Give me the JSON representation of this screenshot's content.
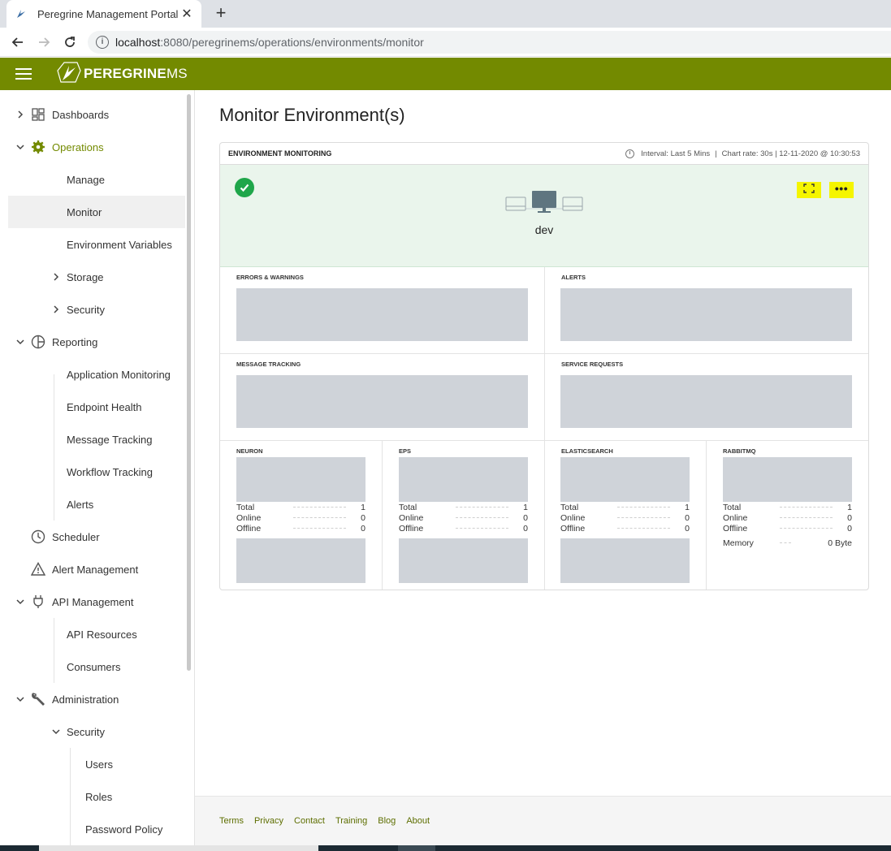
{
  "browser": {
    "tab_title": "Peregrine Management Portal",
    "url_host": "localhost",
    "url_path": ":8080/peregrinems/operations/environments/monitor"
  },
  "header": {
    "brand_bold": "PEREGRINE",
    "brand_light": "MS",
    "accent_color": "#738a00"
  },
  "sidebar": {
    "dashboards": "Dashboards",
    "operations": "Operations",
    "manage": "Manage",
    "monitor": "Monitor",
    "environment_variables": "Environment Variables",
    "storage": "Storage",
    "security": "Security",
    "reporting": "Reporting",
    "application_monitoring": "Application Monitoring",
    "endpoint_health": "Endpoint Health",
    "message_tracking": "Message Tracking",
    "workflow_tracking": "Workflow Tracking",
    "alerts": "Alerts",
    "scheduler": "Scheduler",
    "alert_management": "Alert Management",
    "api_management": "API Management",
    "api_resources": "API Resources",
    "consumers": "Consumers",
    "administration": "Administration",
    "admin_security": "Security",
    "users": "Users",
    "roles": "Roles",
    "password_policy": "Password Policy"
  },
  "main": {
    "page_title": "Monitor Environment(s)",
    "card": {
      "title": "ENVIRONMENT MONITORING",
      "interval": "Interval: Last 5 Mins",
      "chart_rate": "Chart rate: 30s | 12-11-2020 @ 10:30:53",
      "env_name": "dev",
      "status_color": "#1fa64a"
    },
    "panels": {
      "errors": "ERRORS & WARNINGS",
      "alerts": "ALERTS",
      "message_tracking": "MESSAGE TRACKING",
      "service_requests": "SERVICE REQUESTS"
    },
    "nodes": [
      {
        "title": "NEURON",
        "total_label": "Total",
        "total": "1",
        "online_label": "Online",
        "online": "0",
        "offline_label": "Offline",
        "offline": "0"
      },
      {
        "title": "EPS",
        "total_label": "Total",
        "total": "1",
        "online_label": "Online",
        "online": "0",
        "offline_label": "Offline",
        "offline": "0"
      },
      {
        "title": "ELASTICSEARCH",
        "total_label": "Total",
        "total": "1",
        "online_label": "Online",
        "online": "0",
        "offline_label": "Offline",
        "offline": "0"
      },
      {
        "title": "RABBITMQ",
        "total_label": "Total",
        "total": "1",
        "online_label": "Online",
        "online": "0",
        "offline_label": "Offline",
        "offline": "0",
        "memory_label": "Memory",
        "memory": "0 Byte"
      }
    ]
  },
  "footer": {
    "terms": "Terms",
    "privacy": "Privacy",
    "contact": "Contact",
    "training": "Training",
    "blog": "Blog",
    "about": "About"
  }
}
